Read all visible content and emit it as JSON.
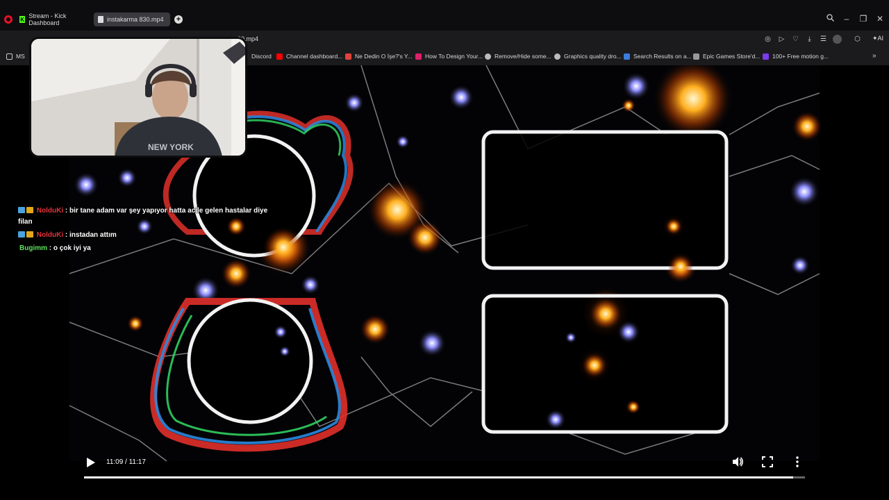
{
  "browser": {
    "tabs": [
      {
        "label": "Stream - Kick Dashboard",
        "icon": "kick-icon",
        "active": false
      },
      {
        "label": "instakarma 830.mp4",
        "icon": "file-icon",
        "active": true
      }
    ],
    "url_fragment": "30.mp4",
    "ai_label": "AI",
    "bookmarks": [
      {
        "label": "MS",
        "icon": "folder-icon",
        "color": "#d8d8d8"
      },
      {
        "label": "Discord",
        "icon": "discord-icon",
        "color": "#5865f2"
      },
      {
        "label": "Channel dashboard...",
        "icon": "youtube-icon",
        "color": "#ff0000"
      },
      {
        "label": "Ne Dedin O İşe?'s Y...",
        "icon": "chart-icon",
        "color": "#e0433b"
      },
      {
        "label": "How To Design Your...",
        "icon": "figma-icon",
        "color": "#e01f6a"
      },
      {
        "label": "Remove/Hide some...",
        "icon": "gear-icon",
        "color": "#bbbbbb"
      },
      {
        "label": "Graphics quality dro...",
        "icon": "gear-icon",
        "color": "#bbbbbb"
      },
      {
        "label": "Search Results on a...",
        "icon": "search-icon",
        "color": "#3b7dd8"
      },
      {
        "label": "Epic Games Store'd...",
        "icon": "epic-icon",
        "color": "#999999"
      },
      {
        "label": "100+ Free motion g...",
        "icon": "motion-icon",
        "color": "#7c3aed"
      }
    ]
  },
  "chat": {
    "messages": [
      {
        "user": "NolduKi",
        "user_color": "#e0343a",
        "text": ": bir tane adam var şey yapıyor hatta acile gelen hastalar diye",
        "continuation": "filan",
        "badges": true
      },
      {
        "user": "NolduKi",
        "user_color": "#e0343a",
        "text": ": instadan attım",
        "continuation": "",
        "badges": true
      },
      {
        "user": "Bugimm",
        "user_color": "#5fe05f",
        "text": ": o çok iyi ya",
        "continuation": "",
        "badges": false
      }
    ]
  },
  "player": {
    "time_display": "11:09 / 11:17",
    "progress_fraction": 0.984,
    "state": "paused"
  }
}
